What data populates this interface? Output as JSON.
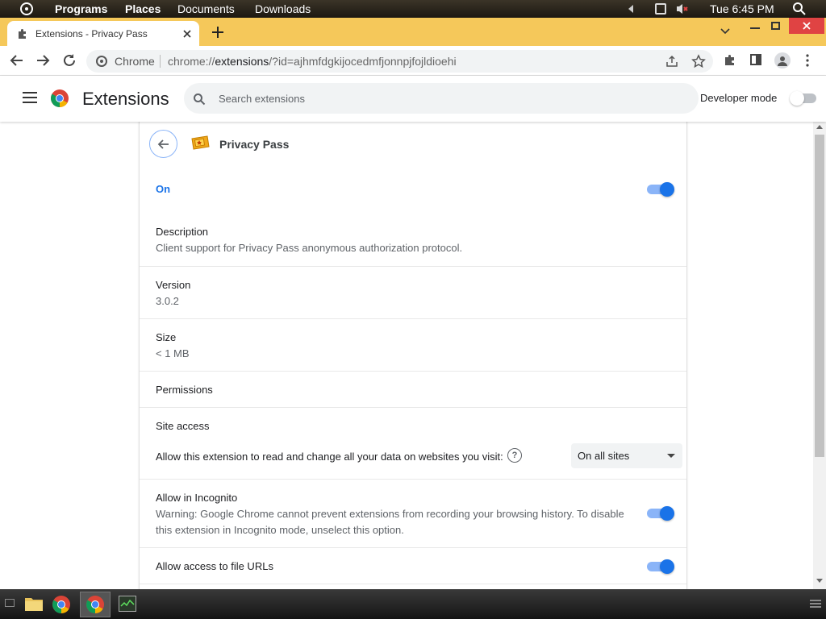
{
  "system_bar": {
    "programs": "Programs",
    "places": "Places",
    "documents": "Documents",
    "downloads": "Downloads",
    "clock": "Tue 6:45 PM"
  },
  "browser": {
    "tab_title": "Extensions - Privacy Pass",
    "omnibox_label": "Chrome",
    "url_prefix": "chrome://",
    "url_host": "extensions",
    "url_rest": "/?id=ajhmfdgkijocedmfjonnpjfojldioehi"
  },
  "extensions_page": {
    "title": "Extensions",
    "search_placeholder": "Search extensions",
    "developer_mode_label": "Developer mode"
  },
  "detail": {
    "name": "Privacy Pass",
    "state_label": "On",
    "description_label": "Description",
    "description_value": "Client support for Privacy Pass anonymous authorization protocol.",
    "version_label": "Version",
    "version_value": "3.0.2",
    "size_label": "Size",
    "size_value": "< 1 MB",
    "permissions_label": "Permissions",
    "site_access_label": "Site access",
    "site_access_text": "Allow this extension to read and change all your data on websites you visit:",
    "site_access_selected": "On all sites",
    "incognito_label": "Allow in Incognito",
    "incognito_warning_1": "Warning: Google Chrome cannot prevent extensions from recording your browsing history. To disable",
    "incognito_warning_2": "this extension in Incognito mode, unselect this option.",
    "file_urls_label": "Allow access to file URLs"
  },
  "colors": {
    "accent": "#1a73e8",
    "tabstrip": "#f5c85a",
    "close_button": "#e04343"
  }
}
